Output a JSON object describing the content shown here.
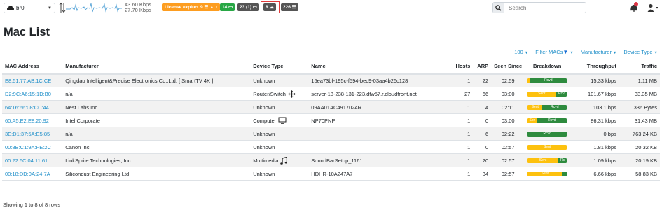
{
  "topbar": {
    "interface": "br0",
    "speed_up": "43.60 Kbps",
    "speed_down": "27.70 Kbps",
    "license": "License expires in 07:40",
    "alert_count": "9",
    "flows_count": "14",
    "devices_count": "23 (1)",
    "hosts_count": "8",
    "list_count": "226",
    "search_placeholder": "Search"
  },
  "page_title": "Mac List",
  "filters": {
    "rows": "100",
    "filter_macs": "Filter MACs",
    "manufacturer": "Manufacturer",
    "device_type": "Device Type"
  },
  "columns": [
    "MAC Address",
    "Manufacturer",
    "Device Type",
    "Name",
    "Hosts",
    "ARP",
    "Seen Since",
    "Breakdown",
    "Throughput",
    "Traffic"
  ],
  "rows": [
    {
      "mac": "E8:51:77:AB:1C:CE",
      "manufacturer": "Qingdao Intelligent&Precise Electronics Co.,Ltd. [ SmartTV 4K ]",
      "device_type": "Unknown",
      "device_icon": "",
      "name": "15ea73bf-195c-f594-bec9-03aa4b26c128",
      "hosts": "1",
      "arp": "22",
      "seen_since": "02:59",
      "breakdown_sent": "",
      "breakdown_rcvd": "Rcvd",
      "sent_pct": 6,
      "throughput": "15.33 kbps",
      "traffic": "1.11 MB"
    },
    {
      "mac": "D2:9C:A6:15:1D:B0",
      "manufacturer": "n/a",
      "device_type": "Router/Switch",
      "device_icon": "arrows-move-icon",
      "name": "server-18-238-131-223.dfw57.r.cloudfront.net",
      "hosts": "27",
      "arp": "66",
      "seen_since": "03:00",
      "breakdown_sent": "Sent",
      "breakdown_rcvd": "Rcv",
      "sent_pct": 72,
      "throughput": "101.67 kbps",
      "traffic": "33.35 MB"
    },
    {
      "mac": "64:16:66:08:CC:44",
      "manufacturer": "Nest Labs Inc.",
      "device_type": "Unknown",
      "device_icon": "",
      "name": "09AA01AC4917024R",
      "hosts": "1",
      "arp": "4",
      "seen_since": "02:11",
      "breakdown_sent": "Sent",
      "breakdown_rcvd": "Rcvd",
      "sent_pct": 38,
      "throughput": "103.1 bps",
      "traffic": "336 Bytes"
    },
    {
      "mac": "60:A5:E2:E8:20:92",
      "manufacturer": "Intel Corporate",
      "device_type": "Computer",
      "device_icon": "desktop-icon",
      "name": "NP70PNP",
      "hosts": "1",
      "arp": "0",
      "seen_since": "03:00",
      "breakdown_sent": "Sen",
      "breakdown_rcvd": "Rcvd",
      "sent_pct": 24,
      "throughput": "86.31 kbps",
      "traffic": "31.43 MB"
    },
    {
      "mac": "3E:D1:37:5A:E5:85",
      "manufacturer": "n/a",
      "device_type": "Unknown",
      "device_icon": "",
      "name": "",
      "hosts": "1",
      "arp": "6",
      "seen_since": "02:22",
      "breakdown_sent": "",
      "breakdown_rcvd": "Rcvd",
      "sent_pct": 0,
      "throughput": "0 bps",
      "traffic": "763.24 KB"
    },
    {
      "mac": "00:8B:C1:9A:FE:2C",
      "manufacturer": "Canon Inc.",
      "device_type": "Unknown",
      "device_icon": "",
      "name": "",
      "hosts": "1",
      "arp": "0",
      "seen_since": "02:57",
      "breakdown_sent": "Sent",
      "breakdown_rcvd": "",
      "sent_pct": 100,
      "throughput": "1.81 kbps",
      "traffic": "20.32 KB"
    },
    {
      "mac": "00:22:6C:04:11:61",
      "manufacturer": "LinkSprite Technologies, Inc.",
      "device_type": "Multimedia",
      "device_icon": "music-note-icon",
      "name": "SoundBarSetup_1161",
      "hosts": "1",
      "arp": "20",
      "seen_since": "02:57",
      "breakdown_sent": "Sent",
      "breakdown_rcvd": "Rc",
      "sent_pct": 78,
      "throughput": "1.09 kbps",
      "traffic": "20.19 KB"
    },
    {
      "mac": "00:18:DD:0A:24:7A",
      "manufacturer": "Silicondust Engineering Ltd",
      "device_type": "Unknown",
      "device_icon": "",
      "name": "HDHR-10A247A7",
      "hosts": "1",
      "arp": "34",
      "seen_since": "02:57",
      "breakdown_sent": "Sent",
      "breakdown_rcvd": "",
      "sent_pct": 88,
      "throughput": "6.66 kbps",
      "traffic": "58.83 KB"
    }
  ],
  "footer": "Showing 1 to 8 of 8 rows",
  "colors": {
    "link": "#1f8fc9",
    "sent": "#fdc10e",
    "rcvd": "#2e8b3e",
    "license": "#fd9d20",
    "flows": "#28a745",
    "highlight": "#e03a3a"
  }
}
